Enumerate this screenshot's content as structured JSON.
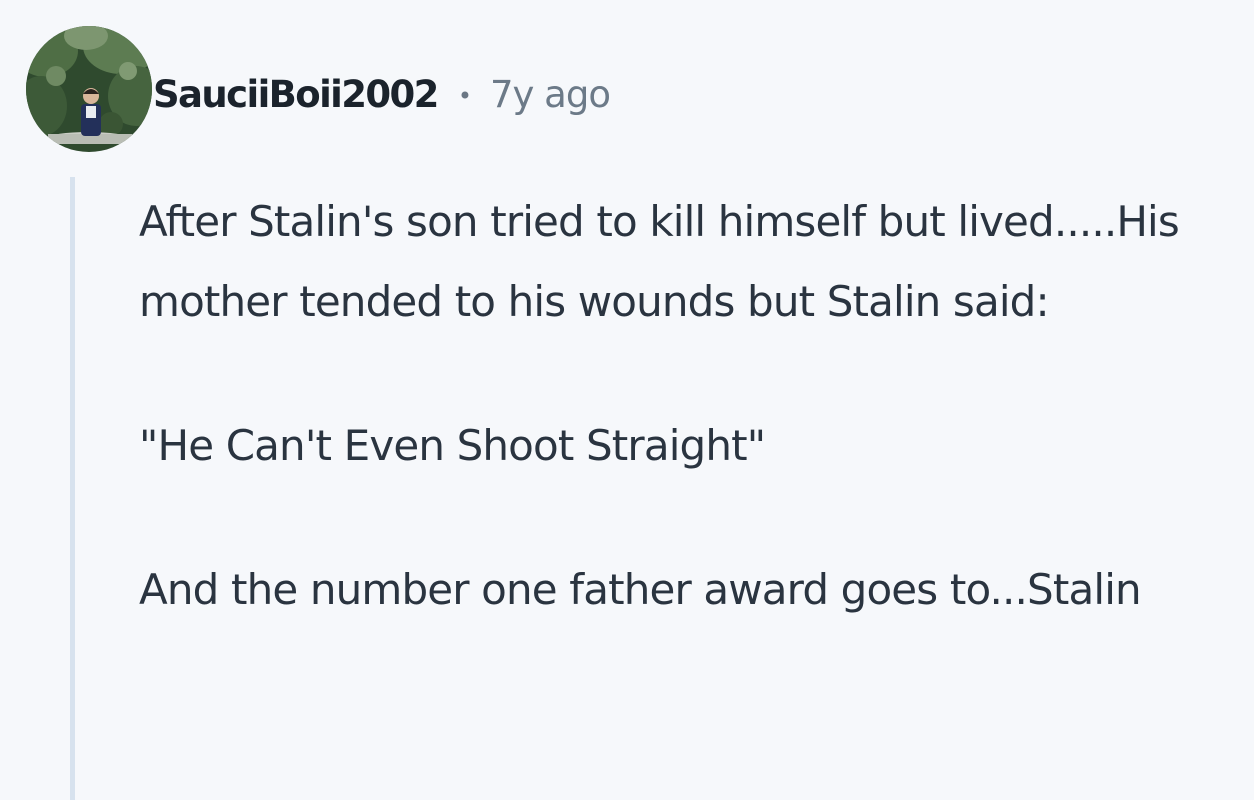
{
  "comment": {
    "author": "SauciiBoii2002",
    "separator": "•",
    "time_ago": "7y ago",
    "paragraphs": [
      "After Stalin's son tried to kill himself but lived.....His mother tended to his wounds but Stalin said:",
      "\"He Can't Even Shoot Straight\"",
      "And the number one father award goes to...Stalin"
    ]
  },
  "icons": {
    "avatar": "user-avatar-photo"
  },
  "colors": {
    "background": "#f6f8fb",
    "text": "#2a3440",
    "author": "#1b232c",
    "meta": "#6c7a88",
    "thread_line": "#d7e2ee"
  }
}
